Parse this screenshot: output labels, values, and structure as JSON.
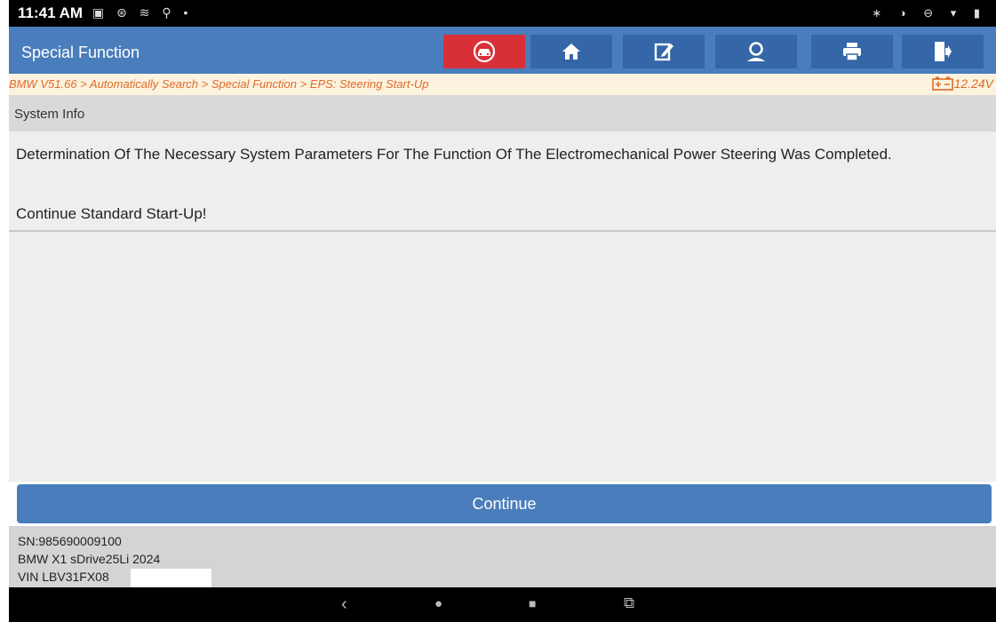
{
  "status_bar": {
    "time": "11:41 AM",
    "left_icons": "▣ ⊛ ≋ ⚲ •",
    "right_icons": "∗ ◑ ⊖ ▾ ▮"
  },
  "title_bar": {
    "title": "Special Function",
    "buttons": [
      "car-diagnose-icon",
      "home-icon",
      "edit-icon",
      "support-icon",
      "print-icon",
      "exit-icon"
    ],
    "colors": {
      "bar": "#4a7dbb",
      "button": "#3566a8",
      "active_button": "#d93038"
    }
  },
  "breadcrumb": {
    "path": "BMW V51.66 > Automatically Search > Special Function > EPS: Steering Start-Up",
    "voltage": "12.24V",
    "color": "#e06a2a"
  },
  "system_info": {
    "label": "System Info"
  },
  "message": {
    "line1": "Determination Of The Necessary System Parameters For The Function Of The Electromechanical Power Steering Was Completed.",
    "line2": "Continue Standard Start-Up!"
  },
  "actions": {
    "continue_label": "Continue"
  },
  "footer": {
    "sn": "SN:985690009100",
    "vehicle": "BMW X1 sDrive25Li 2024",
    "vin": "VIN LBV31FX08"
  },
  "nav_bar": {
    "back": "‹",
    "home": "●",
    "recents": "■",
    "screenshot": "⧉"
  }
}
